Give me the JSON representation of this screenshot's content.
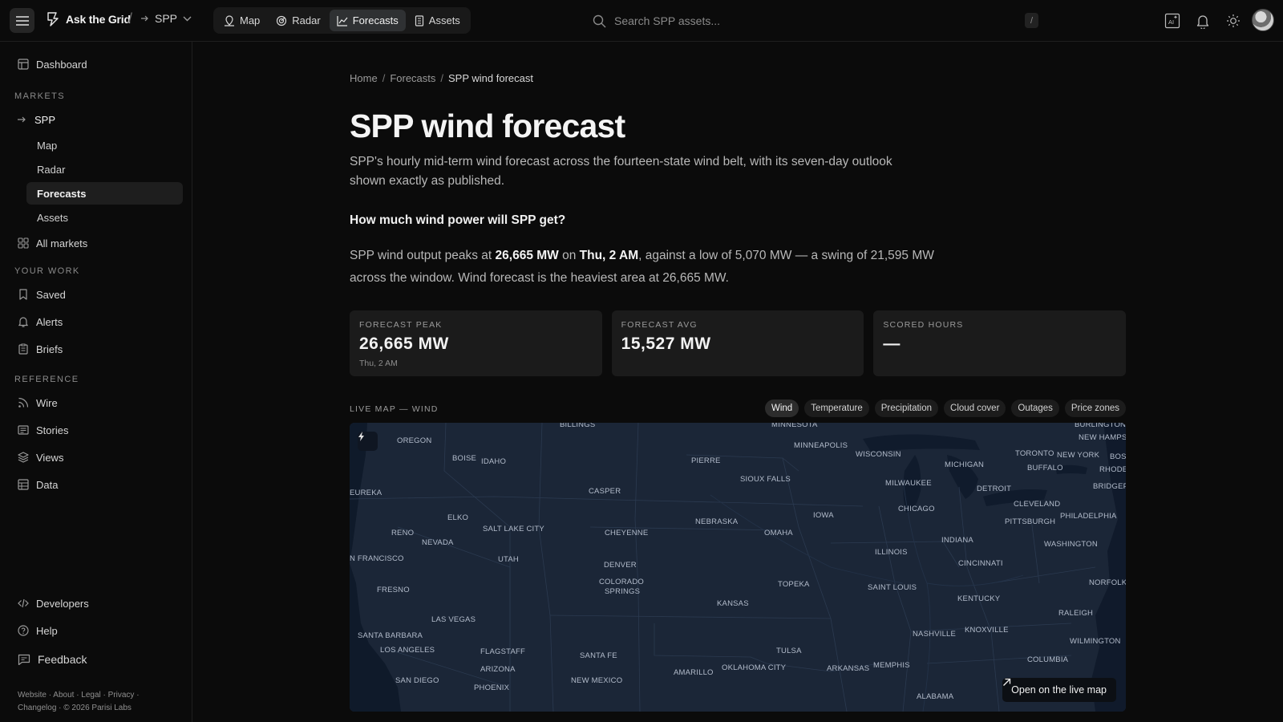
{
  "app": {
    "brand": "Ask the Grid",
    "market": "SPP",
    "search_placeholder": "Search SPP assets...",
    "search_shortcut": "/"
  },
  "nav": {
    "tabs": [
      {
        "label": "Map",
        "icon": "map-icon"
      },
      {
        "label": "Radar",
        "icon": "radar-icon"
      },
      {
        "label": "Forecasts",
        "icon": "chart-icon",
        "active": true
      },
      {
        "label": "Assets",
        "icon": "building-icon"
      }
    ]
  },
  "sidebar": {
    "dashboard": "Dashboard",
    "markets_heading": "MARKETS",
    "market": "SPP",
    "market_items": [
      "Map",
      "Radar",
      "Forecasts",
      "Assets"
    ],
    "all_markets": "All markets",
    "work_heading": "YOUR WORK",
    "work_items": [
      "Saved",
      "Alerts",
      "Briefs"
    ],
    "reference_heading": "REFERENCE",
    "reference_items": [
      "Wire",
      "Stories",
      "Views",
      "Data"
    ],
    "developers": "Developers",
    "help": "Help",
    "feedback": "Feedback",
    "footer_line1": "Website · About · Legal · Privacy ·",
    "footer_line2": "Changelog · © 2026 Parisi Labs"
  },
  "page": {
    "breadcrumb": [
      "Home",
      "Forecasts",
      "SPP wind forecast"
    ],
    "title": "SPP wind forecast",
    "lede": "SPP's hourly mid-term wind forecast across the fourteen-state wind belt, with its seven-day outlook shown exactly as published.",
    "question": "How much wind power will SPP get?",
    "summary": {
      "p1": "SPP wind output peaks at ",
      "peak": "26,665 MW",
      "p2": " on ",
      "peak_time": "Thu, 2 AM",
      "p3": ", against a low of 5,070 MW — a swing of 21,595 MW across the window. Wind forecast is the heaviest area at 26,665 MW."
    },
    "cards": [
      {
        "label": "FORECAST PEAK",
        "value": "26,665 MW",
        "sub": "Thu, 2 AM"
      },
      {
        "label": "FORECAST AVG",
        "value": "15,527 MW",
        "sub": ""
      },
      {
        "label": "SCORED HOURS",
        "value": "—",
        "sub": ""
      }
    ],
    "map_label": "LIVE MAP — WIND",
    "layers": [
      "Wind",
      "Temperature",
      "Precipitation",
      "Cloud cover",
      "Outages",
      "Price zones"
    ],
    "active_layer": "Wind",
    "open_live": "Open on the live map"
  },
  "map_labels": [
    "BILLINGS",
    "MINNESOTA",
    "BURLINGTON",
    "OREGON",
    "NEW HAMPS",
    "BOISE",
    "IDAHO",
    "PIERRE",
    "MINNEAPOLIS",
    "WISCONSIN",
    "TORONTO",
    "NEW YORK",
    "BOS",
    "BUFFALO",
    "RHODE I",
    "MICHIGAN",
    "SIOUX FALLS",
    "EUREKA",
    "CASPER",
    "MILWAUKEE",
    "DETROIT",
    "BRIDGEPO",
    "CLEVELAND",
    "ELKO",
    "CHICAGO",
    "IOWA",
    "PHILADELPHIA",
    "NEBRASKA",
    "PITTSBURGH",
    "SALT LAKE CITY",
    "RENO",
    "CHEYENNE",
    "OMAHA",
    "NEVADA",
    "INDIANA",
    "WASHINGTON",
    "ILLINOIS",
    "N FRANCISCO",
    "UTAH",
    "CINCINNATI",
    "DENVER",
    "COLORADO",
    "SPRINGS",
    "NORFOLK",
    "FRESNO",
    "TOPEKA",
    "SAINT LOUIS",
    "KENTUCKY",
    "KANSAS",
    "RALEIGH",
    "LAS VEGAS",
    "NASHVILLE",
    "KNOXVILLE",
    "WILMINGTON",
    "SANTA BARBARA",
    "LOS ANGELES",
    "FLAGSTAFF",
    "TULSA",
    "SANTA FE",
    "COLUMBIA",
    "MEMPHIS",
    "ARIZONA",
    "ARKANSAS",
    "AMARILLO",
    "OKLAHOMA CITY",
    "SAN DIEGO",
    "NEW MEXICO",
    "PHOENIX",
    "ALABAMA"
  ]
}
